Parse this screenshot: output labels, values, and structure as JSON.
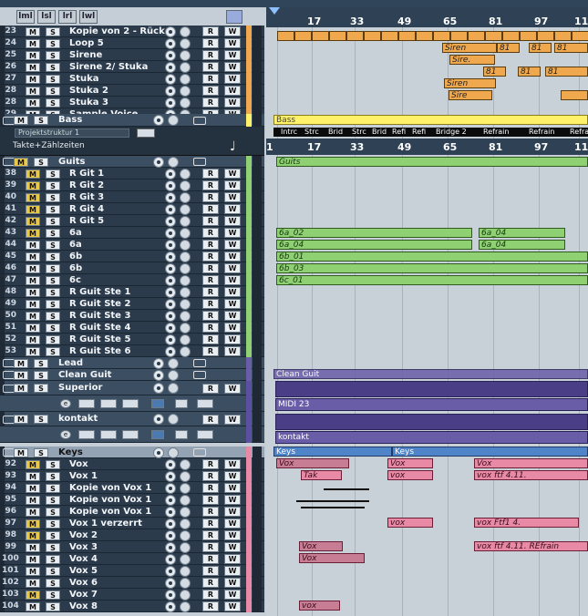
{
  "toolbar": {
    "buttons": [
      "lml",
      "lsl",
      "lrl",
      "lwl"
    ]
  },
  "arranger_ruler": [
    "17",
    "33",
    "49",
    "65",
    "81",
    "97",
    "11"
  ],
  "track_ruler": [
    "1",
    "17",
    "33",
    "49",
    "65",
    "81",
    "97",
    "11"
  ],
  "arranger_sections": [
    "Intrc",
    "Strc",
    "Brid",
    "Strc",
    "Brid",
    "Refi",
    "Refi",
    "Bridge 2",
    "Refrain",
    "Refrain",
    "Refra"
  ],
  "tracks": {
    "top": [
      {
        "num": "23",
        "name": "Kopie von 2 - Rück",
        "color": "#f0a84e"
      },
      {
        "num": "24",
        "name": "Loop 5",
        "color": "#f0a84e"
      },
      {
        "num": "25",
        "name": "Sirene",
        "color": "#f0a84e"
      },
      {
        "num": "26",
        "name": "Sirene 2/ Stuka",
        "color": "#f0a84e"
      },
      {
        "num": "27",
        "name": "Stuka",
        "color": "#f0a84e"
      },
      {
        "num": "28",
        "name": "Stuka 2",
        "color": "#f0a84e"
      },
      {
        "num": "28",
        "name": "Stuka 3",
        "color": "#f0a84e"
      },
      {
        "num": "29",
        "name": "Sample Voice",
        "color": "#f0a84e"
      }
    ],
    "bass": {
      "name": "Bass",
      "struct": "Projektstruktur 1",
      "zaehl": "Takte+Zählzeiten"
    },
    "guits": [
      {
        "num": "",
        "name": "Guits",
        "grp": true,
        "color": "#8ed072"
      },
      {
        "num": "38",
        "name": "R Git 1",
        "color": "#8ed072"
      },
      {
        "num": "39",
        "name": "R Git 2",
        "color": "#8ed072"
      },
      {
        "num": "40",
        "name": "R Git 3",
        "color": "#8ed072"
      },
      {
        "num": "41",
        "name": "R Git 4",
        "color": "#8ed072"
      },
      {
        "num": "42",
        "name": "R Git 5",
        "color": "#8ed072"
      },
      {
        "num": "43",
        "name": "6a",
        "color": "#8ed072"
      },
      {
        "num": "44",
        "name": "6a",
        "color": "#8ed072"
      },
      {
        "num": "45",
        "name": "6b",
        "color": "#8ed072"
      },
      {
        "num": "46",
        "name": "6b",
        "color": "#8ed072"
      },
      {
        "num": "47",
        "name": "6c",
        "color": "#8ed072"
      },
      {
        "num": "48",
        "name": "R Guit Ste 1",
        "color": "#8ed072"
      },
      {
        "num": "49",
        "name": "R Guit Ste 2",
        "color": "#8ed072"
      },
      {
        "num": "50",
        "name": "R Guit Ste 3",
        "color": "#8ed072"
      },
      {
        "num": "51",
        "name": "R Guit Ste 4",
        "color": "#8ed072"
      },
      {
        "num": "52",
        "name": "R Guit Ste 5",
        "color": "#8ed072"
      },
      {
        "num": "53",
        "name": "R Guit Ste 6",
        "color": "#8ed072"
      }
    ],
    "groups": [
      {
        "name": "Lead"
      },
      {
        "name": "Clean Guit"
      },
      {
        "name": "Superior"
      },
      {
        "name": "kontakt"
      }
    ],
    "keys": {
      "name": "Keys"
    },
    "vox": [
      {
        "num": "92",
        "name": "Vox",
        "m": true
      },
      {
        "num": "93",
        "name": "Vox 1",
        "m": false
      },
      {
        "num": "94",
        "name": "Kopie von  Vox 1",
        "m": false
      },
      {
        "num": "95",
        "name": "Kopie von  Vox 1",
        "m": false
      },
      {
        "num": "96",
        "name": "Kopie von  Vox 1",
        "m": false
      },
      {
        "num": "97",
        "name": "Vox 1 verzerrt",
        "m": true
      },
      {
        "num": "98",
        "name": "Vox 2",
        "m": true
      },
      {
        "num": "99",
        "name": "Vox 3",
        "m": false
      },
      {
        "num": "100",
        "name": "Vox 4",
        "m": false
      },
      {
        "num": "101",
        "name": "Vox 5",
        "m": false
      },
      {
        "num": "102",
        "name": "Vox 6",
        "m": false
      },
      {
        "num": "103",
        "name": "Vox 7",
        "m": true
      },
      {
        "num": "104",
        "name": "Vox 8",
        "m": false
      }
    ]
  },
  "events": {
    "sirene": [
      "Siren",
      "81",
      "81",
      "81"
    ],
    "sire": "Sire.",
    "stuka": [
      "81",
      "81",
      "81"
    ],
    "stuka2": "Siren",
    "stuka3": "Sire",
    "bass": "Bass",
    "guits": "Guits",
    "g6a1": [
      "6a_02",
      "6a_04"
    ],
    "g6a2": [
      "6a_04",
      "6a_04"
    ],
    "g6b1": "6b_01",
    "g6b2": "6b_03",
    "g6c": "6c_01",
    "clean": "Clean Guit",
    "midi": "MIDI 23",
    "kontakt": "kontakt",
    "keys": "Keys",
    "keys2": "Keys",
    "vox": [
      "Vox",
      "Vox",
      "Vox"
    ],
    "vox1": [
      "Tak",
      "vox",
      "vox ftf 4.11."
    ],
    "vox97": [
      "vox",
      "vox Ftf1 4."
    ],
    "vox99": [
      "Vox",
      "vox ftf 4.11. REfrain"
    ],
    "vox100": "Vox",
    "vox104": "vox"
  },
  "ms": {
    "m": "M",
    "s": "S",
    "r": "R",
    "w": "W"
  }
}
